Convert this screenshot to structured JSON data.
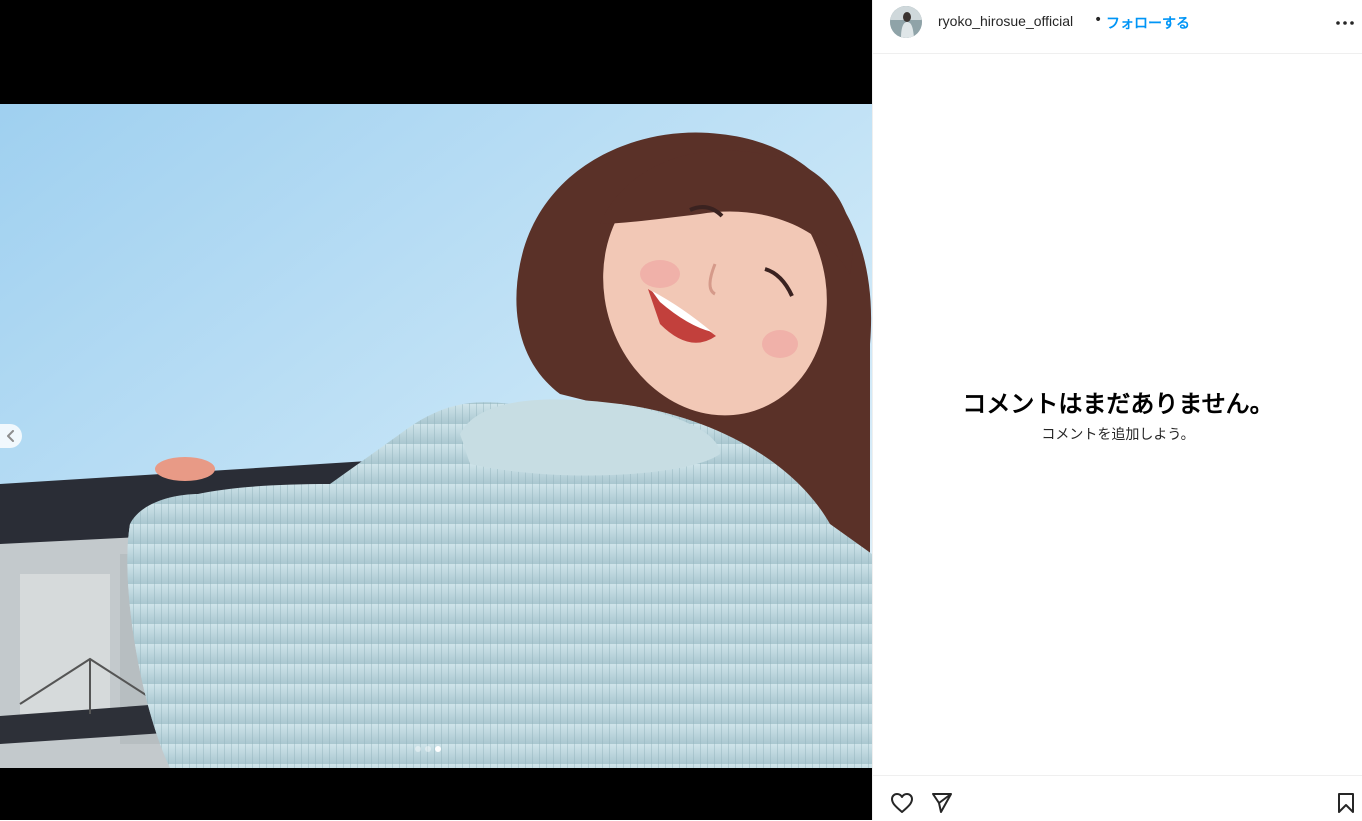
{
  "post": {
    "username": "ryoko_hirosue_official",
    "separator": "•",
    "follow_label": "フォローする",
    "more_icon": "more-horizontal-icon"
  },
  "media": {
    "carousel_count": 3,
    "active_index": 3,
    "prev_icon": "chevron-left-icon"
  },
  "comments": {
    "empty_title": "コメントはまだありません。",
    "empty_subtitle": "コメントを追加しよう。"
  },
  "actions": {
    "like_icon": "heart-icon",
    "share_icon": "paper-plane-icon",
    "save_icon": "bookmark-icon"
  },
  "colors": {
    "accent": "#0095f6",
    "text": "#262626",
    "divider": "#efefef"
  }
}
